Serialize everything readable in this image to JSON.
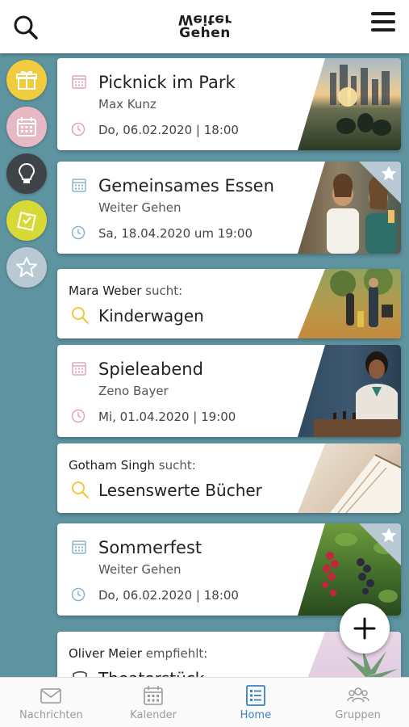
{
  "header": {
    "logo_line1": "Weiter",
    "logo_line2": "Gehen"
  },
  "cards": [
    {
      "type": "event",
      "title": "Picknick im Park",
      "subtitle": "Max Kunz",
      "date": "Do, 06.02.2020 | 18:00",
      "accent": "#e3a6b4",
      "starred": false
    },
    {
      "type": "event",
      "title": "Gemeinsames Essen",
      "subtitle": "Weiter Gehen",
      "date": "Sa, 18.04.2020 um 19:00",
      "accent": "#8db4c7",
      "starred": true
    },
    {
      "type": "search",
      "person": "Mara Weber",
      "verb": "sucht:",
      "title": "Kinderwagen"
    },
    {
      "type": "event",
      "title": "Spieleabend",
      "subtitle": "Zeno Bayer",
      "date": "Mi, 01.04.2020 | 19:00",
      "accent": "#e3a6b4",
      "starred": false
    },
    {
      "type": "search",
      "person": "Gotham Singh",
      "verb": "sucht:",
      "title": "Lesenswerte Bücher"
    },
    {
      "type": "event",
      "title": "Sommerfest",
      "subtitle": "Weiter Gehen",
      "date": "Do, 06.02.2020 | 18:00",
      "accent": "#8db4c7",
      "starred": true
    },
    {
      "type": "recommend",
      "person": "Oliver Meier",
      "verb": "empfiehlt:",
      "title": "Theaterstück"
    }
  ],
  "side_filters": [
    {
      "icon": "gift-icon",
      "color": "#f2cc3f"
    },
    {
      "icon": "calendar-icon",
      "color": "#e8b8c4"
    },
    {
      "icon": "lightbulb-icon",
      "color": "#3f4448"
    },
    {
      "icon": "note-icon",
      "color": "#d6d936"
    },
    {
      "icon": "star-icon",
      "color": "#b9c9d3"
    }
  ],
  "tabs": [
    {
      "label": "Nachrichten",
      "icon": "mail-icon",
      "active": false
    },
    {
      "label": "Kalender",
      "icon": "calendar-icon",
      "active": false
    },
    {
      "label": "Home",
      "icon": "home-list-icon",
      "active": true
    },
    {
      "label": "Gruppen",
      "icon": "group-icon",
      "active": false
    }
  ],
  "colors": {
    "background": "#5e93a0",
    "active_tab": "#3a7fc4",
    "search_icon": "#f0c83c"
  }
}
